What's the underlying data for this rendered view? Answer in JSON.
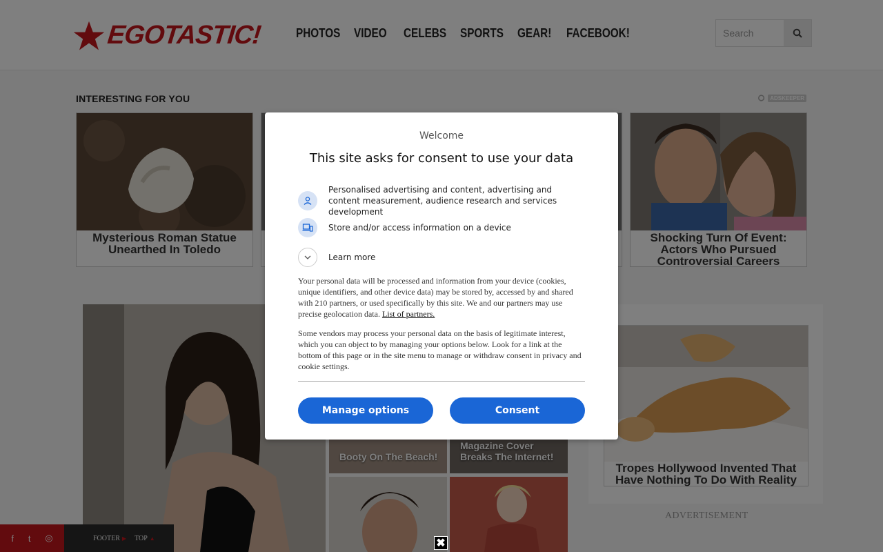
{
  "header": {
    "logo_text": "EGOTASTIC!",
    "nav": [
      "PHOTOS",
      "VIDEO",
      "CELEBS",
      "SPORTS",
      "GEAR!",
      "FACEBOOK!"
    ],
    "search_placeholder": "Search"
  },
  "section": {
    "title": "INTERESTING FOR YOU",
    "sponsor": "ADSKEEPER"
  },
  "cards": [
    {
      "title": "Mysterious Roman Statue Unearthed In Toledo"
    },
    {
      "title": "Shocking Turn Of Event: Actors Who Pursued Controversial Careers"
    }
  ],
  "thumbs": [
    {
      "caption": "Booty On The Beach!"
    },
    {
      "caption": "Magazine Cover Breaks The Internet!"
    }
  ],
  "right_card": {
    "title": "Tropes Hollywood Invented That Have Nothing To Do With Reality"
  },
  "ad_label": "ADVERTISEMENT",
  "footer": {
    "links": [
      "FOOTER",
      "TOP"
    ]
  },
  "consent": {
    "welcome": "Welcome",
    "title": "This site asks for consent to use your data",
    "purposes": [
      {
        "text": "Personalised advertising and content, advertising and content measurement, audience research and services development",
        "icon": "person-icon"
      },
      {
        "text": "Store and/or access information on a device",
        "icon": "devices-icon"
      }
    ],
    "learn_more": "Learn more",
    "para1": "Your personal data will be processed and information from your device (cookies, unique identifiers, and other device data) may be stored by, accessed by and shared with 210 partners, or used specifically by this site. We and our partners may use precise geolocation data.",
    "partners_link": "List of partners.",
    "para2": "Some vendors may process your personal data on the basis of legitimate interest, which you can object to by managing your options below. Look for a link at the bottom of this page or in the site menu to manage or withdraw consent in privacy and cookie settings.",
    "manage_button": "Manage options",
    "consent_button": "Consent"
  },
  "colors": {
    "brand_red": "#c4161c",
    "button_blue": "#1a66d6"
  }
}
